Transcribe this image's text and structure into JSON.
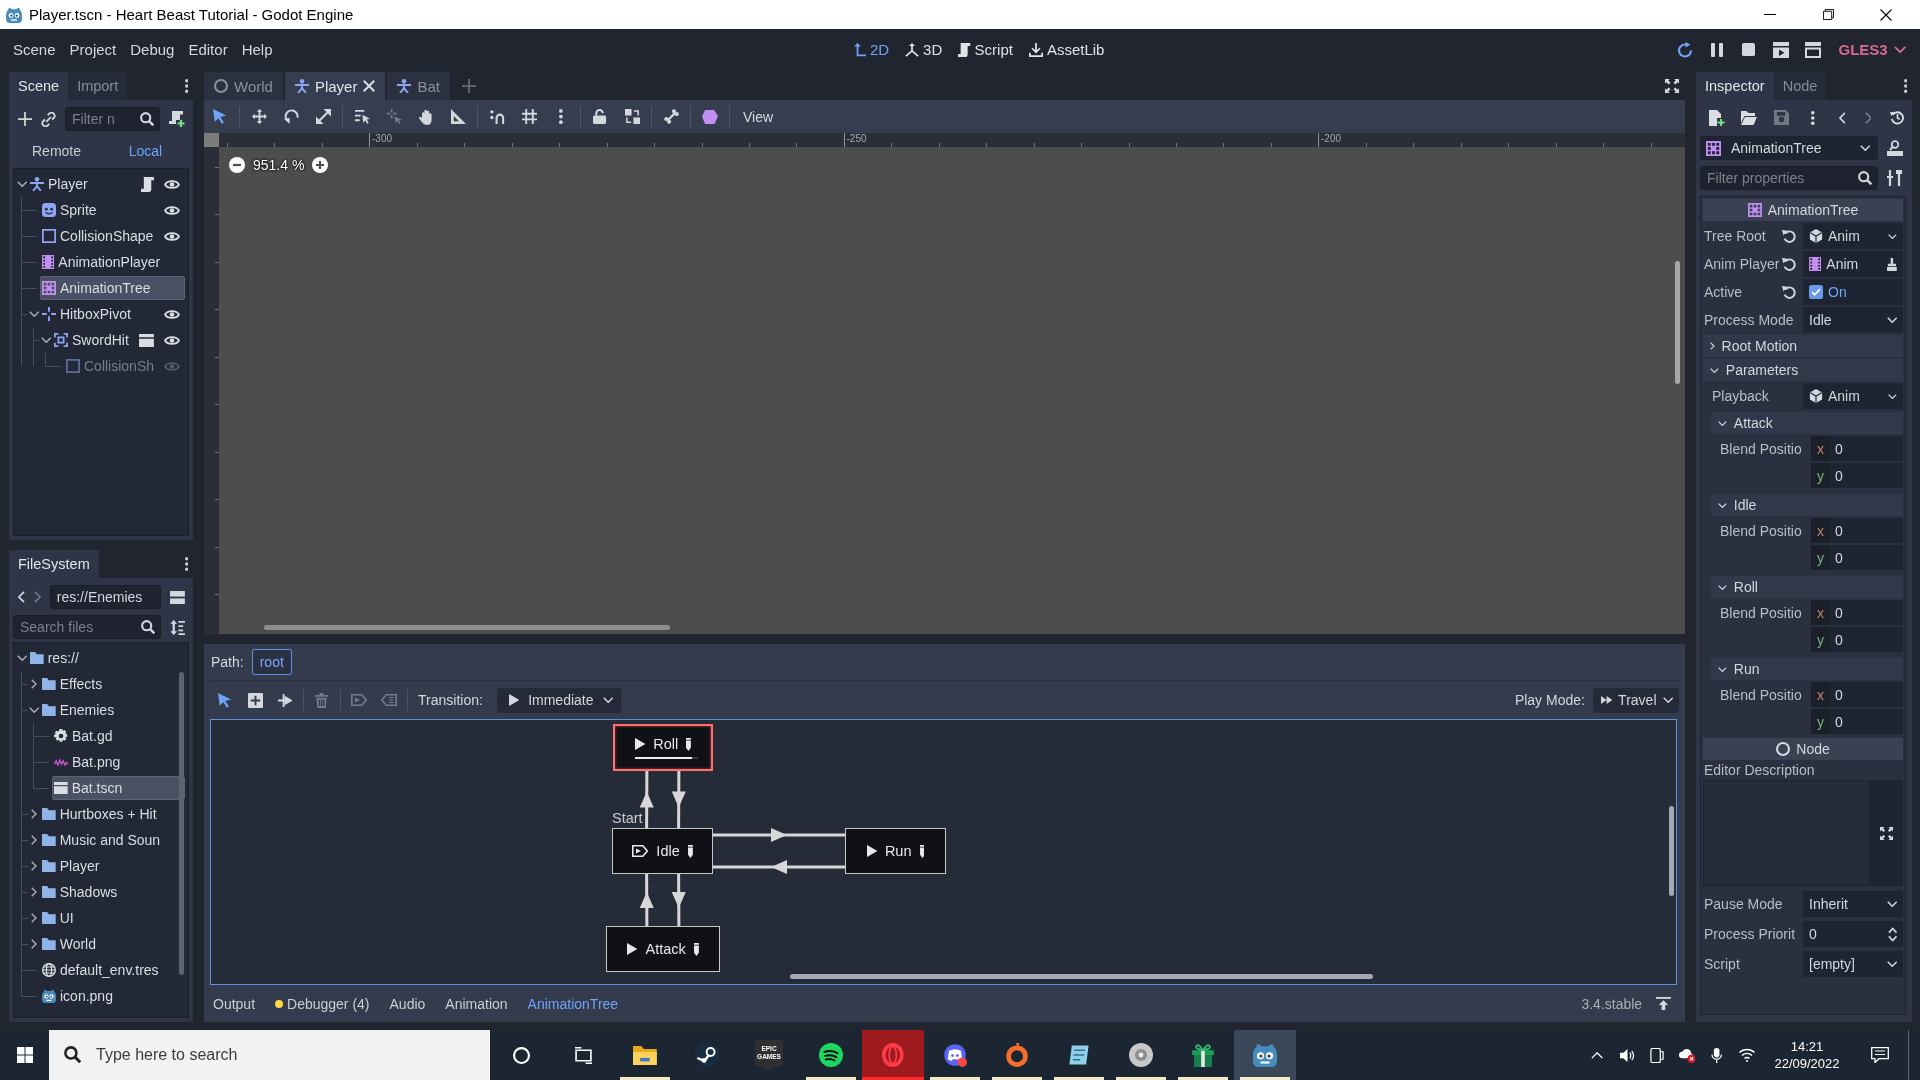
{
  "window": {
    "title": "Player.tscn - Heart Beast Tutorial - Godot Engine"
  },
  "menu": [
    "Scene",
    "Project",
    "Debug",
    "Editor",
    "Help"
  ],
  "workspaces": [
    {
      "label": "2D",
      "kind": "canvas",
      "selected": true
    },
    {
      "label": "3D",
      "kind": "spatial",
      "selected": false
    },
    {
      "label": "Script",
      "kind": "script",
      "selected": false
    },
    {
      "label": "AssetLib",
      "kind": "assetlib",
      "selected": false
    }
  ],
  "renderer": "GLES3",
  "scene_dock": {
    "tabs": [
      {
        "label": "Scene",
        "selected": true
      },
      {
        "label": "Import",
        "selected": false
      }
    ],
    "filter": {
      "placeholder": "Filter n"
    },
    "views": [
      {
        "label": "Remote",
        "selected": false
      },
      {
        "label": "Local",
        "selected": true
      }
    ],
    "tree": [
      {
        "name": "Player",
        "kind": "kinematic",
        "scripted": true,
        "instanced": false,
        "eye": true,
        "selected": false,
        "disabled": false,
        "expanded": true,
        "children": [
          {
            "name": "Sprite",
            "kind": "sprite",
            "scripted": false,
            "instanced": false,
            "eye": true,
            "selected": false,
            "disabled": false
          },
          {
            "name": "CollisionShape",
            "kind": "shape",
            "scripted": false,
            "instanced": false,
            "eye": true,
            "selected": false,
            "disabled": false
          },
          {
            "name": "AnimationPlayer",
            "kind": "animplayer",
            "scripted": false,
            "instanced": false,
            "eye": false,
            "selected": false,
            "disabled": false
          },
          {
            "name": "AnimationTree",
            "kind": "animtree",
            "scripted": false,
            "instanced": false,
            "eye": false,
            "selected": true,
            "disabled": false
          },
          {
            "name": "HitboxPivot",
            "kind": "position",
            "scripted": false,
            "instanced": false,
            "eye": true,
            "selected": false,
            "disabled": false,
            "expanded": true,
            "children": [
              {
                "name": "SwordHit",
                "kind": "area",
                "scripted": false,
                "instanced": true,
                "eye": true,
                "selected": false,
                "disabled": false,
                "expanded": true,
                "children": [
                  {
                    "name": "CollisionSh",
                    "kind": "shape",
                    "scripted": false,
                    "instanced": false,
                    "eye": true,
                    "selected": false,
                    "disabled": true
                  }
                ]
              }
            ]
          }
        ]
      }
    ]
  },
  "filesystem": {
    "tab": "FileSystem",
    "path": "res://Enemies",
    "search": {
      "placeholder": "Search files"
    },
    "tree": [
      {
        "name": "res://",
        "kind": "folder",
        "selected": false,
        "expanded": true,
        "children": [
          {
            "name": "Effects",
            "kind": "folder",
            "selected": false,
            "expanded": false
          },
          {
            "name": "Enemies",
            "kind": "folder",
            "selected": false,
            "expanded": true,
            "children": [
              {
                "name": "Bat.gd",
                "kind": "script",
                "selected": false
              },
              {
                "name": "Bat.png",
                "kind": "image",
                "selected": false
              },
              {
                "name": "Bat.tscn",
                "kind": "scene",
                "selected": true
              }
            ]
          },
          {
            "name": "Hurtboxes + Hit",
            "kind": "folder",
            "selected": false,
            "expanded": false
          },
          {
            "name": "Music and Soun",
            "kind": "folder",
            "selected": false,
            "expanded": false
          },
          {
            "name": "Player",
            "kind": "folder",
            "selected": false,
            "expanded": false
          },
          {
            "name": "Shadows",
            "kind": "folder",
            "selected": false,
            "expanded": false
          },
          {
            "name": "UI",
            "kind": "folder",
            "selected": false,
            "expanded": false
          },
          {
            "name": "World",
            "kind": "folder",
            "selected": false,
            "expanded": false
          },
          {
            "name": "default_env.tres",
            "kind": "environment",
            "selected": false
          },
          {
            "name": "icon.png",
            "kind": "godot",
            "selected": false
          }
        ]
      }
    ]
  },
  "scene_tabs": [
    {
      "label": "World",
      "kind": "node",
      "selected": false
    },
    {
      "label": "Player",
      "kind": "kinematic",
      "selected": true
    },
    {
      "label": "Bat",
      "kind": "kinematic",
      "selected": false
    }
  ],
  "canvas": {
    "view_menu": "View",
    "ruler_labels": [
      "-300",
      "-250",
      "-200"
    ],
    "zoom": "951.4 %"
  },
  "animation_tree": {
    "path_label": "Path:",
    "path": "root",
    "transition_label": "Transition:",
    "transition": "Immediate",
    "play_mode_label": "Play Mode:",
    "play_mode": "Travel",
    "nodes": [
      {
        "name": "Roll",
        "kind": "animation",
        "playing": true,
        "level": 0.9
      },
      {
        "name": "Idle",
        "kind": "autoplay",
        "playing": false,
        "start_label": "Start"
      },
      {
        "name": "Run",
        "kind": "animation",
        "playing": false
      },
      {
        "name": "Attack",
        "kind": "animation",
        "playing": false
      }
    ]
  },
  "bottom_tabs": [
    {
      "label": "Output",
      "selected": false,
      "alert": false
    },
    {
      "label": "Debugger (4)",
      "selected": false,
      "alert": true
    },
    {
      "label": "Audio",
      "selected": false,
      "alert": false
    },
    {
      "label": "Animation",
      "selected": false,
      "alert": false
    },
    {
      "label": "AnimationTree",
      "selected": true,
      "alert": false
    }
  ],
  "version": "3.4.stable",
  "inspector": {
    "tabs": [
      {
        "label": "Inspector",
        "selected": true
      },
      {
        "label": "Node",
        "selected": false
      }
    ],
    "object": {
      "kind": "animtree",
      "name": "AnimationTree"
    },
    "filter": {
      "placeholder": "Filter properties"
    },
    "class_header": {
      "kind": "animtree",
      "name": "AnimationTree"
    },
    "properties": [
      {
        "label": "Tree Root",
        "kind": "resource",
        "value": "Anim",
        "revert": true
      },
      {
        "label": "Anim Player",
        "kind": "nodepath",
        "value": "Anim",
        "revert": true
      },
      {
        "label": "Active",
        "kind": "check",
        "value": "On",
        "checked": true,
        "revert": true
      },
      {
        "label": "Process Mode",
        "kind": "enum",
        "value": "Idle",
        "revert": false
      }
    ],
    "sections": [
      {
        "label": "Root Motion",
        "expanded": false
      },
      {
        "label": "Parameters",
        "expanded": true,
        "properties": [
          {
            "label": "Playback",
            "kind": "resource",
            "value": "Anim",
            "revert": false
          }
        ],
        "groups": [
          {
            "label": "Attack",
            "expanded": true,
            "properties": [
              {
                "label": "Blend Positio",
                "kind": "vector",
                "components": [
                  {
                    "axis": "x",
                    "value": "0"
                  },
                  {
                    "axis": "y",
                    "value": "0"
                  }
                ]
              }
            ]
          },
          {
            "label": "Idle",
            "expanded": true,
            "properties": [
              {
                "label": "Blend Positio",
                "kind": "vector",
                "components": [
                  {
                    "axis": "x",
                    "value": "0"
                  },
                  {
                    "axis": "y",
                    "value": "0"
                  }
                ]
              }
            ]
          },
          {
            "label": "Roll",
            "expanded": true,
            "properties": [
              {
                "label": "Blend Positio",
                "kind": "vector",
                "components": [
                  {
                    "axis": "x",
                    "value": "0"
                  },
                  {
                    "axis": "y",
                    "value": "0"
                  }
                ]
              }
            ]
          },
          {
            "label": "Run",
            "expanded": true,
            "properties": [
              {
                "label": "Blend Positio",
                "kind": "vector",
                "components": [
                  {
                    "axis": "x",
                    "value": "0"
                  },
                  {
                    "axis": "y",
                    "value": "0"
                  }
                ]
              }
            ]
          }
        ]
      }
    ],
    "node_header": {
      "kind": "node",
      "name": "Node"
    },
    "node_properties": [
      {
        "label": "Editor Description",
        "kind": "textarea"
      },
      {
        "label": "Pause Mode",
        "kind": "enum",
        "value": "Inherit",
        "revert": false
      },
      {
        "label": "Process Priorit",
        "kind": "spin",
        "value": "0",
        "revert": false
      },
      {
        "label": "Script",
        "kind": "enum",
        "value": "[empty]",
        "revert": false
      }
    ]
  },
  "taskbar": {
    "search": {
      "placeholder": "Type here to search"
    },
    "apps": [
      {
        "kind": "folder",
        "active": false,
        "flashing": false,
        "running": true
      },
      {
        "kind": "steam",
        "active": false,
        "flashing": false,
        "running": false
      },
      {
        "kind": "epic",
        "active": false,
        "flashing": false,
        "running": false,
        "label": "EPIC GAMES"
      },
      {
        "kind": "spotify",
        "active": false,
        "flashing": false,
        "running": true
      },
      {
        "kind": "opera",
        "active": false,
        "flashing": true,
        "running": true
      },
      {
        "kind": "discord",
        "active": false,
        "flashing": false,
        "running": true
      },
      {
        "kind": "origin",
        "active": false,
        "flashing": false,
        "running": true
      },
      {
        "kind": "notes",
        "active": false,
        "flashing": false,
        "running": true
      },
      {
        "kind": "disc",
        "active": false,
        "flashing": false,
        "running": true
      },
      {
        "kind": "gift",
        "active": false,
        "flashing": false,
        "running": true
      },
      {
        "kind": "godot",
        "active": true,
        "flashing": false,
        "running": true
      }
    ],
    "time": "14:21",
    "date": "22/09/2022"
  }
}
